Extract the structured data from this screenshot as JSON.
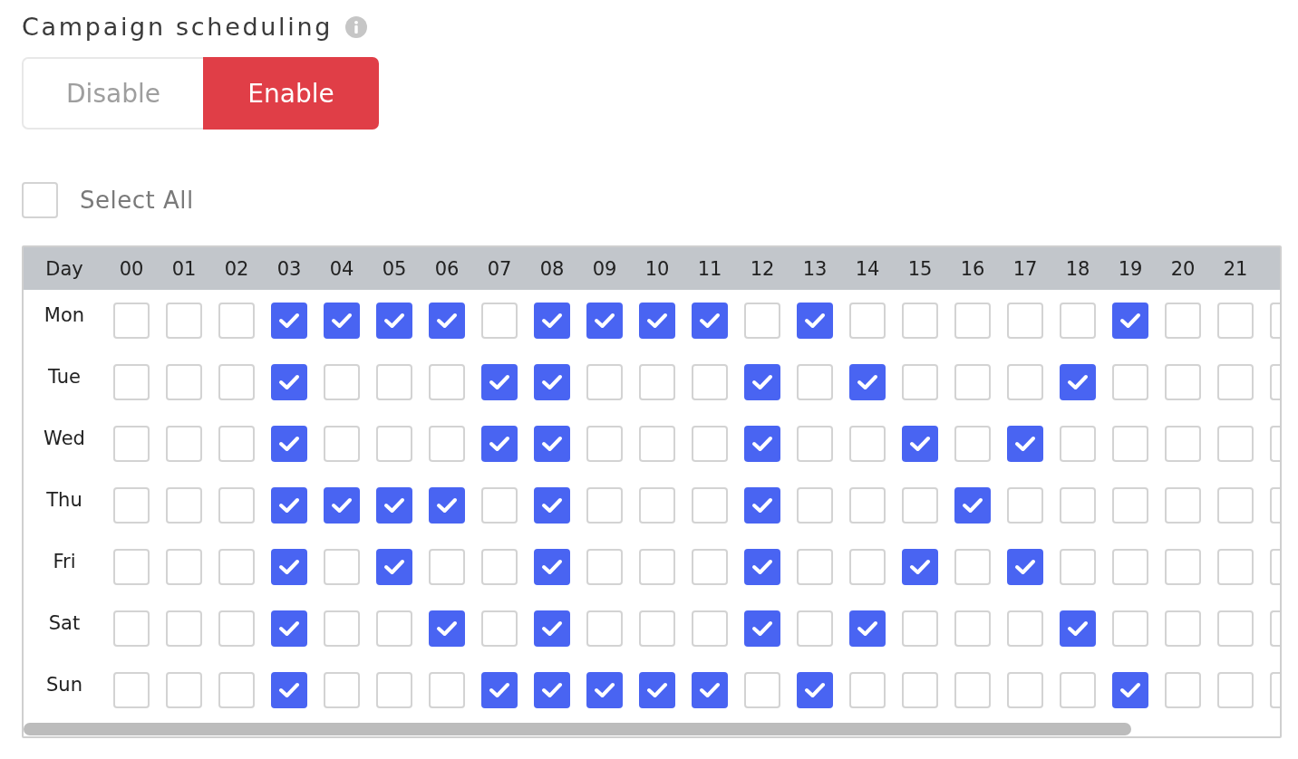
{
  "title": "Campaign scheduling",
  "scheduling_toggle": [
    {
      "label": "Disable",
      "selected": false
    },
    {
      "label": "Enable",
      "selected": true
    }
  ],
  "select_all": {
    "label": "Select All",
    "checked": false
  },
  "schedule_table": {
    "columns": [
      "Day",
      "00",
      "01",
      "02",
      "03",
      "04",
      "05",
      "06",
      "07",
      "08",
      "09",
      "10",
      "11",
      "12",
      "13",
      "14",
      "15",
      "16",
      "17",
      "18",
      "19",
      "20",
      "21"
    ],
    "rows": [
      {
        "day": "Mon",
        "slots": [
          {
            "checked": false
          },
          {
            "checked": false
          },
          {
            "checked": false
          },
          {
            "checked": true
          },
          {
            "checked": true
          },
          {
            "checked": true
          },
          {
            "checked": true
          },
          {
            "checked": false
          },
          {
            "checked": true
          },
          {
            "checked": true
          },
          {
            "checked": true
          },
          {
            "checked": true
          },
          {
            "checked": false
          },
          {
            "checked": true
          },
          {
            "checked": false
          },
          {
            "checked": false
          },
          {
            "checked": false
          },
          {
            "checked": false
          },
          {
            "checked": false
          },
          {
            "checked": true
          },
          {
            "checked": false
          },
          {
            "checked": false
          },
          {
            "checked": false
          }
        ]
      },
      {
        "day": "Tue",
        "slots": [
          {
            "checked": false
          },
          {
            "checked": false
          },
          {
            "checked": false
          },
          {
            "checked": true
          },
          {
            "checked": false
          },
          {
            "checked": false
          },
          {
            "checked": false
          },
          {
            "checked": true
          },
          {
            "checked": true
          },
          {
            "checked": false
          },
          {
            "checked": false
          },
          {
            "checked": false
          },
          {
            "checked": true
          },
          {
            "checked": false
          },
          {
            "checked": true
          },
          {
            "checked": false
          },
          {
            "checked": false
          },
          {
            "checked": false
          },
          {
            "checked": true
          },
          {
            "checked": false
          },
          {
            "checked": false
          },
          {
            "checked": false
          },
          {
            "checked": false
          }
        ]
      },
      {
        "day": "Wed",
        "slots": [
          {
            "checked": false
          },
          {
            "checked": false
          },
          {
            "checked": false
          },
          {
            "checked": true
          },
          {
            "checked": false
          },
          {
            "checked": false
          },
          {
            "checked": false
          },
          {
            "checked": true
          },
          {
            "checked": true
          },
          {
            "checked": false
          },
          {
            "checked": false
          },
          {
            "checked": false
          },
          {
            "checked": true
          },
          {
            "checked": false
          },
          {
            "checked": false
          },
          {
            "checked": true
          },
          {
            "checked": false
          },
          {
            "checked": true
          },
          {
            "checked": false
          },
          {
            "checked": false
          },
          {
            "checked": false
          },
          {
            "checked": false
          },
          {
            "checked": false
          }
        ]
      },
      {
        "day": "Thu",
        "slots": [
          {
            "checked": false
          },
          {
            "checked": false
          },
          {
            "checked": false
          },
          {
            "checked": true
          },
          {
            "checked": true
          },
          {
            "checked": true
          },
          {
            "checked": true
          },
          {
            "checked": false
          },
          {
            "checked": true
          },
          {
            "checked": false
          },
          {
            "checked": false
          },
          {
            "checked": false
          },
          {
            "checked": true
          },
          {
            "checked": false
          },
          {
            "checked": false
          },
          {
            "checked": false
          },
          {
            "checked": true
          },
          {
            "checked": false
          },
          {
            "checked": false
          },
          {
            "checked": false
          },
          {
            "checked": false
          },
          {
            "checked": false
          },
          {
            "checked": false
          }
        ]
      },
      {
        "day": "Fri",
        "slots": [
          {
            "checked": false
          },
          {
            "checked": false
          },
          {
            "checked": false
          },
          {
            "checked": true
          },
          {
            "checked": false
          },
          {
            "checked": true
          },
          {
            "checked": false
          },
          {
            "checked": false
          },
          {
            "checked": true
          },
          {
            "checked": false
          },
          {
            "checked": false
          },
          {
            "checked": false
          },
          {
            "checked": true
          },
          {
            "checked": false
          },
          {
            "checked": false
          },
          {
            "checked": true
          },
          {
            "checked": false
          },
          {
            "checked": true
          },
          {
            "checked": false
          },
          {
            "checked": false
          },
          {
            "checked": false
          },
          {
            "checked": false
          },
          {
            "checked": false
          }
        ]
      },
      {
        "day": "Sat",
        "slots": [
          {
            "checked": false
          },
          {
            "checked": false
          },
          {
            "checked": false
          },
          {
            "checked": true
          },
          {
            "checked": false
          },
          {
            "checked": false
          },
          {
            "checked": true
          },
          {
            "checked": false
          },
          {
            "checked": true
          },
          {
            "checked": false
          },
          {
            "checked": false
          },
          {
            "checked": false
          },
          {
            "checked": true
          },
          {
            "checked": false
          },
          {
            "checked": true
          },
          {
            "checked": false
          },
          {
            "checked": false
          },
          {
            "checked": false
          },
          {
            "checked": true
          },
          {
            "checked": false
          },
          {
            "checked": false
          },
          {
            "checked": false
          },
          {
            "checked": false
          }
        ]
      },
      {
        "day": "Sun",
        "slots": [
          {
            "checked": false
          },
          {
            "checked": false
          },
          {
            "checked": false
          },
          {
            "checked": true
          },
          {
            "checked": false
          },
          {
            "checked": false
          },
          {
            "checked": false
          },
          {
            "checked": true
          },
          {
            "checked": true
          },
          {
            "checked": true
          },
          {
            "checked": true
          },
          {
            "checked": true
          },
          {
            "checked": false
          },
          {
            "checked": true
          },
          {
            "checked": false
          },
          {
            "checked": false
          },
          {
            "checked": false
          },
          {
            "checked": false
          },
          {
            "checked": false
          },
          {
            "checked": true
          },
          {
            "checked": false
          },
          {
            "checked": false
          },
          {
            "checked": false
          }
        ]
      }
    ]
  }
}
